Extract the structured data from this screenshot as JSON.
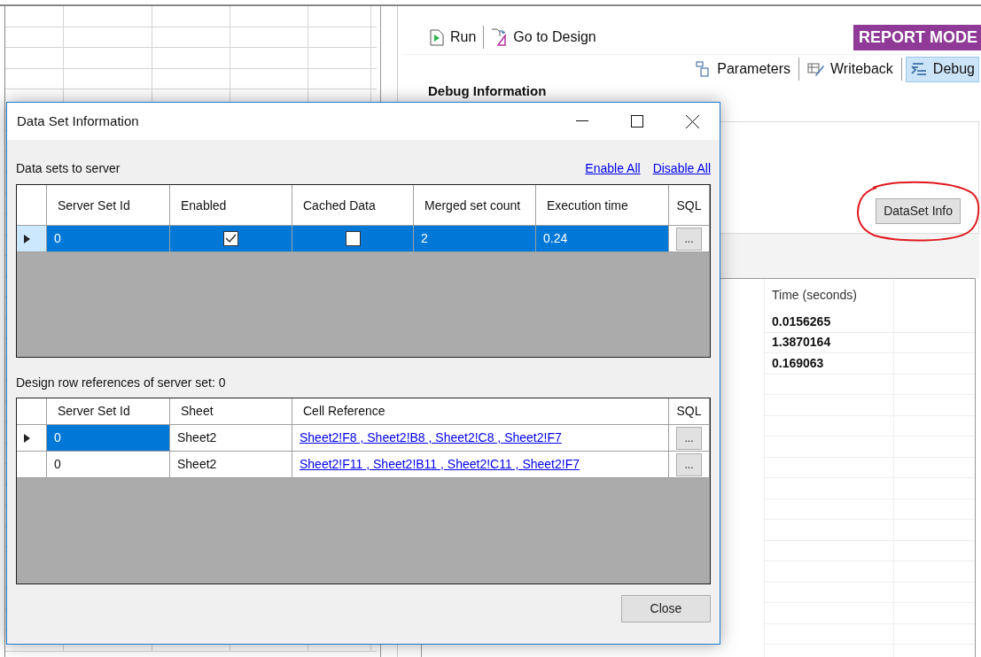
{
  "toolbar": {
    "buttons": [
      {
        "kind": "run",
        "label": "Run"
      },
      {
        "kind": "design",
        "label": "Go to Design"
      }
    ],
    "mode_badge": "REPORT MODE"
  },
  "view_tabs": [
    {
      "kind": "parameters",
      "label": "Parameters",
      "selected": false
    },
    {
      "kind": "writeback",
      "label": "Writeback",
      "selected": false
    },
    {
      "kind": "debug",
      "label": "Debug",
      "selected": true
    }
  ],
  "debug_panel": {
    "heading": "Debug Information",
    "dataset_button": "DataSet Info",
    "timing_table": {
      "column": "Time (seconds)",
      "rows": [
        "0.0156265",
        "1.3870164",
        "0.169063"
      ]
    }
  },
  "dialog": {
    "title": "Data Set Information",
    "server_section": {
      "label": "Data sets to server",
      "links": [
        "Enable All",
        "Disable All"
      ],
      "columns": [
        "Server Set Id",
        "Enabled",
        "Cached Data",
        "Merged set count",
        "Execution time",
        "SQL"
      ],
      "rows": [
        {
          "server_set_id": "0",
          "enabled": true,
          "cached_data": false,
          "merged_set_count": "2",
          "execution_time": "0.24",
          "sql": "...",
          "selected": true
        }
      ]
    },
    "reference_section": {
      "label": "Design row references of server set: 0",
      "columns": [
        "Server Set Id",
        "Sheet",
        "Cell Reference",
        "SQL"
      ],
      "rows": [
        {
          "server_set_id": "0",
          "sheet": "Sheet2",
          "cell_reference": "Sheet2!F8 , Sheet2!B8 , Sheet2!C8 , Sheet2!F7",
          "sql": "...",
          "selected": true
        },
        {
          "server_set_id": "0",
          "sheet": "Sheet2",
          "cell_reference": "Sheet2!F11 , Sheet2!B11 , Sheet2!C11 , Sheet2!F7",
          "sql": "...",
          "selected": false
        }
      ]
    },
    "close_button": "Close"
  }
}
